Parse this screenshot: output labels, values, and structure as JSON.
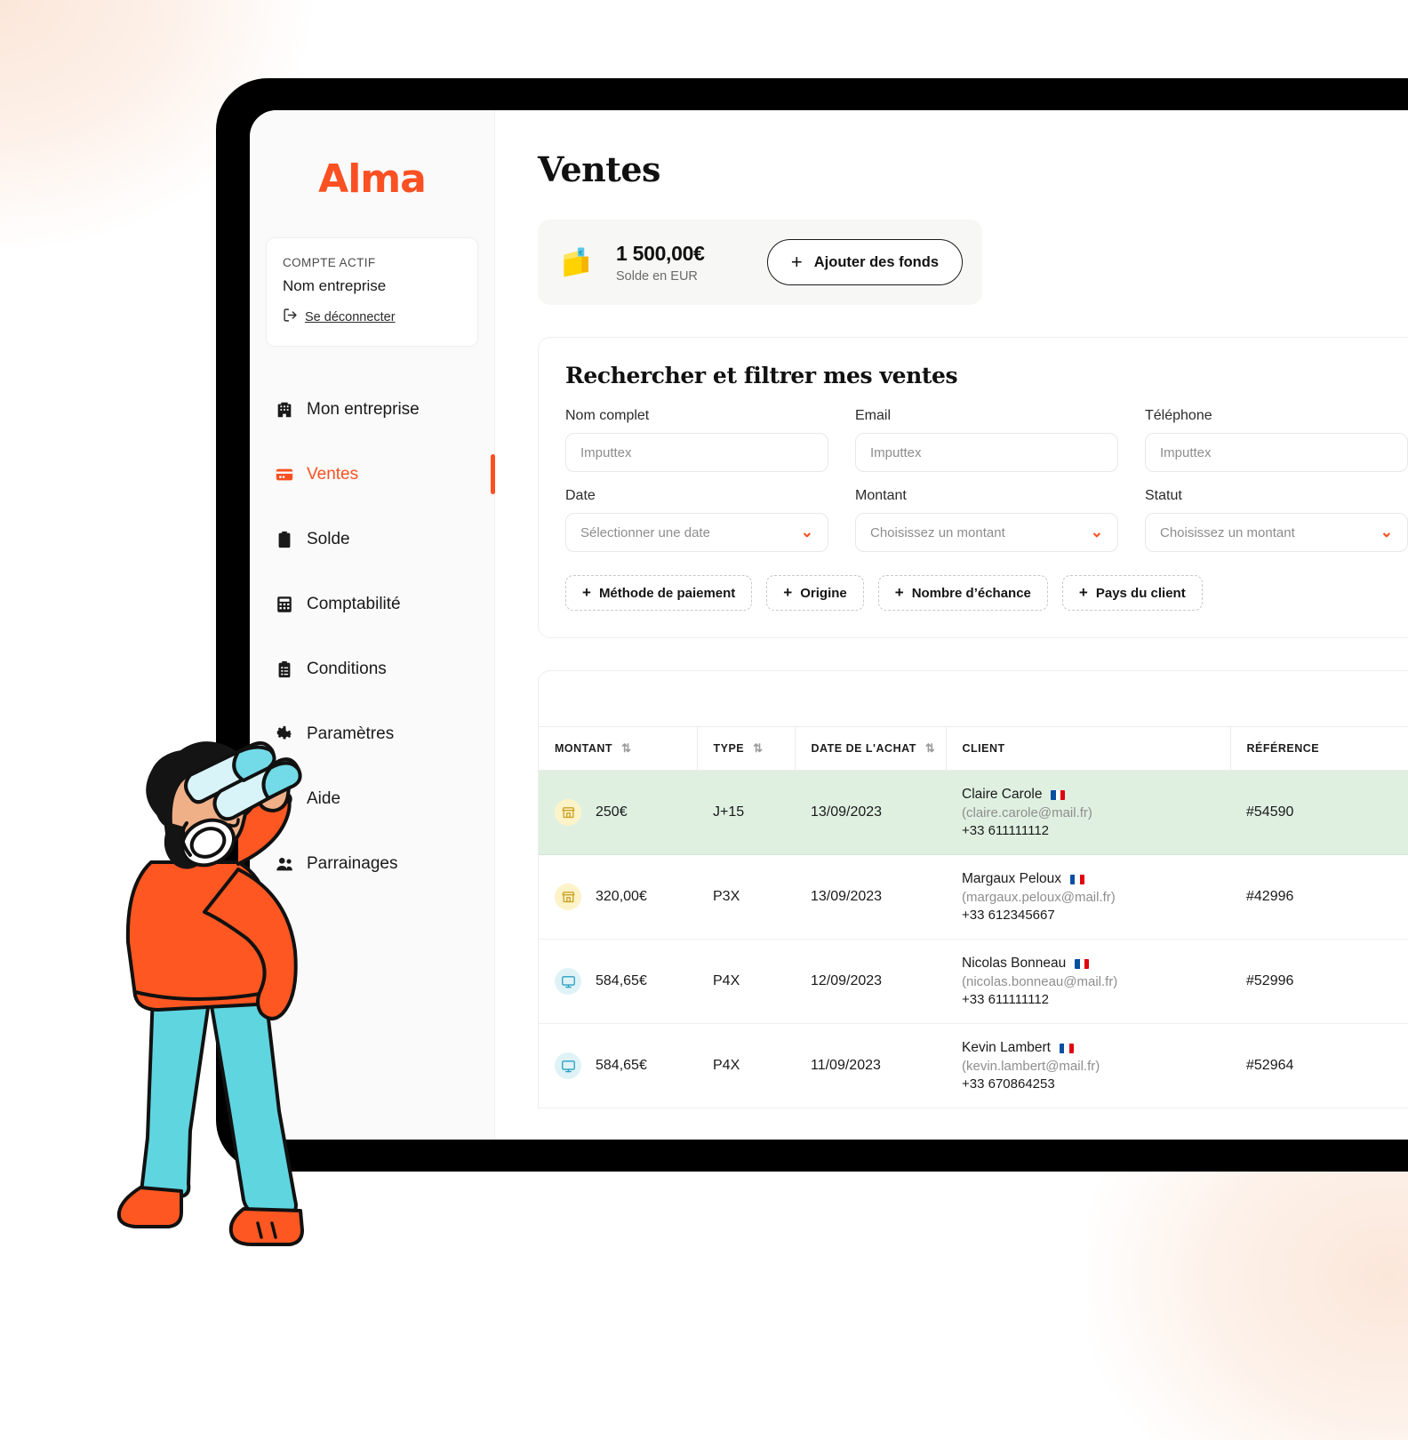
{
  "brand": {
    "name": "Alma",
    "color": "#fa5022"
  },
  "sidebar": {
    "account": {
      "label": "COMPTE ACTIF",
      "company": "Nom entreprise",
      "logout": "Se déconnecter"
    },
    "items": [
      {
        "label": "Mon entreprise",
        "icon": "building-icon",
        "active": false
      },
      {
        "label": "Ventes",
        "icon": "credit-card-icon",
        "active": true
      },
      {
        "label": "Solde",
        "icon": "clipboard-icon",
        "active": false
      },
      {
        "label": "Comptabilité",
        "icon": "calculator-icon",
        "active": false
      },
      {
        "label": "Conditions",
        "icon": "checklist-icon",
        "active": false
      },
      {
        "label": "Paramètres",
        "icon": "gear-icon",
        "active": false
      },
      {
        "label": "Aide",
        "icon": "help-icon",
        "active": false
      },
      {
        "label": "Parrainages",
        "icon": "referral-icon",
        "active": false
      }
    ]
  },
  "main": {
    "title": "Ventes",
    "balance": {
      "amount": "1 500,00€",
      "subtitle": "Solde en EUR",
      "add_funds_label": "Ajouter des fonds",
      "icon": "wallet-icon"
    },
    "filters": {
      "title": "Rechercher et filtrer mes ventes",
      "fields": [
        {
          "label": "Nom complet",
          "value": "",
          "placeholder": "Imputtex",
          "type": "text"
        },
        {
          "label": "Email",
          "value": "",
          "placeholder": "Imputtex",
          "type": "text"
        },
        {
          "label": "Téléphone",
          "value": "",
          "placeholder": "Imputtex",
          "type": "text"
        },
        {
          "label": "Date",
          "value": "Sélectionner une date",
          "placeholder": "Sélectionner une date",
          "type": "select"
        },
        {
          "label": "Montant",
          "value": "Choisissez un montant",
          "placeholder": "Choisissez un montant",
          "type": "select"
        },
        {
          "label": "Statut",
          "value": "Choisissez un montant",
          "placeholder": "Choisissez un montant",
          "type": "select"
        }
      ],
      "chips": [
        "Méthode de paiement",
        "Origine",
        "Nombre d’échance",
        "Pays du client"
      ]
    },
    "table": {
      "columns": [
        {
          "label": "MONTANT",
          "sortable": true
        },
        {
          "label": "TYPE",
          "sortable": true
        },
        {
          "label": "DATE DE L'ACHAT",
          "sortable": true
        },
        {
          "label": "CLIENT",
          "sortable": false
        },
        {
          "label": "RÉFÉRENCE",
          "sortable": false
        }
      ],
      "rows": [
        {
          "icon": "store-icon",
          "icon_style": "store",
          "amount": "250€",
          "type": "J+15",
          "date": "13/09/2023",
          "client_name": "Claire Carole",
          "client_email": "(claire.carole@mail.fr)",
          "client_phone": "+33 611111112",
          "reference": "#54590",
          "highlight": true
        },
        {
          "icon": "store-icon",
          "icon_style": "store",
          "amount": "320,00€",
          "type": "P3X",
          "date": "13/09/2023",
          "client_name": "Margaux Peloux",
          "client_email": "(margaux.peloux@mail.fr)",
          "client_phone": "+33 612345667",
          "reference": "#42996",
          "highlight": false
        },
        {
          "icon": "monitor-icon",
          "icon_style": "screen",
          "amount": "584,65€",
          "type": "P4X",
          "date": "12/09/2023",
          "client_name": "Nicolas Bonneau",
          "client_email": "(nicolas.bonneau@mail.fr)",
          "client_phone": "+33 611111112",
          "reference": "#52996",
          "highlight": false
        },
        {
          "icon": "monitor-icon",
          "icon_style": "screen",
          "amount": "584,65€",
          "type": "P4X",
          "date": "11/09/2023",
          "client_name": "Kevin Lambert",
          "client_email": "(kevin.lambert@mail.fr)",
          "client_phone": "+33 670864253",
          "reference": "#52964",
          "highlight": false
        }
      ]
    }
  },
  "illustration": {
    "name": "person-with-binoculars"
  }
}
